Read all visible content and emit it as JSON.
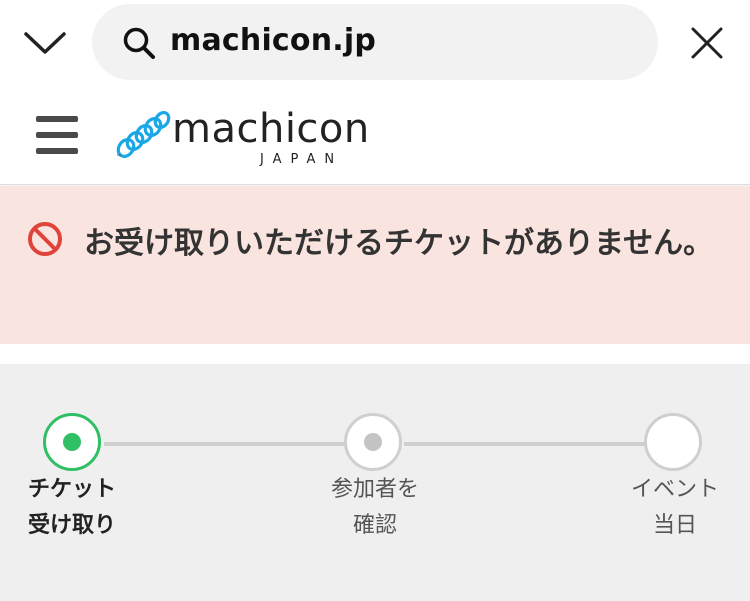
{
  "browser": {
    "url": "machicon.jp",
    "icons": [
      "chevron-down-icon",
      "search-icon",
      "close-icon"
    ]
  },
  "header": {
    "logo_text": "machicon",
    "logo_subtext": "JAPAN",
    "logo_tm": "™",
    "menu_icon": "hamburger-menu-icon"
  },
  "alert": {
    "icon": "prohibited-icon",
    "message": "お受け取りいただけるチケットがありません。",
    "color": "#f9e4e0"
  },
  "steps": [
    {
      "label_line1": "チケット",
      "label_line2": "受け取り",
      "state": "active"
    },
    {
      "label_line1": "参加者を",
      "label_line2": "確認",
      "state": "pending"
    },
    {
      "label_line1": "イベント",
      "label_line2": "当日",
      "state": "upcoming"
    }
  ],
  "colors": {
    "active": "#2fbf64",
    "pending_dot": "#c4c4c4",
    "line": "#cfcfcf",
    "logo_accent": "#1aa7e6"
  }
}
